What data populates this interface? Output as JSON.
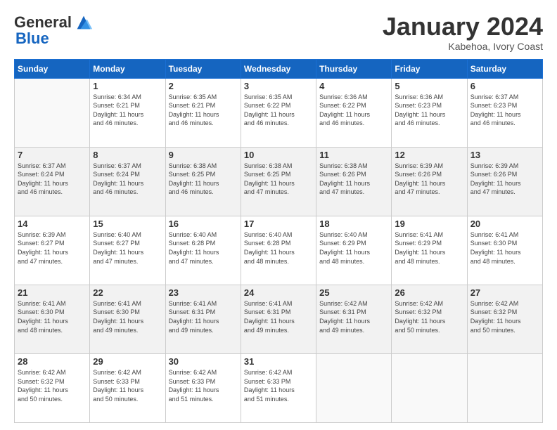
{
  "header": {
    "logo_general": "General",
    "logo_blue": "Blue",
    "month_title": "January 2024",
    "subtitle": "Kabehoa, Ivory Coast"
  },
  "weekdays": [
    "Sunday",
    "Monday",
    "Tuesday",
    "Wednesday",
    "Thursday",
    "Friday",
    "Saturday"
  ],
  "weeks": [
    [
      {
        "day": "",
        "sunrise": "",
        "sunset": "",
        "daylight": ""
      },
      {
        "day": "1",
        "sunrise": "Sunrise: 6:34 AM",
        "sunset": "Sunset: 6:21 PM",
        "daylight": "Daylight: 11 hours and 46 minutes."
      },
      {
        "day": "2",
        "sunrise": "Sunrise: 6:35 AM",
        "sunset": "Sunset: 6:21 PM",
        "daylight": "Daylight: 11 hours and 46 minutes."
      },
      {
        "day": "3",
        "sunrise": "Sunrise: 6:35 AM",
        "sunset": "Sunset: 6:22 PM",
        "daylight": "Daylight: 11 hours and 46 minutes."
      },
      {
        "day": "4",
        "sunrise": "Sunrise: 6:36 AM",
        "sunset": "Sunset: 6:22 PM",
        "daylight": "Daylight: 11 hours and 46 minutes."
      },
      {
        "day": "5",
        "sunrise": "Sunrise: 6:36 AM",
        "sunset": "Sunset: 6:23 PM",
        "daylight": "Daylight: 11 hours and 46 minutes."
      },
      {
        "day": "6",
        "sunrise": "Sunrise: 6:37 AM",
        "sunset": "Sunset: 6:23 PM",
        "daylight": "Daylight: 11 hours and 46 minutes."
      }
    ],
    [
      {
        "day": "7",
        "sunrise": "Sunrise: 6:37 AM",
        "sunset": "Sunset: 6:24 PM",
        "daylight": "Daylight: 11 hours and 46 minutes."
      },
      {
        "day": "8",
        "sunrise": "Sunrise: 6:37 AM",
        "sunset": "Sunset: 6:24 PM",
        "daylight": "Daylight: 11 hours and 46 minutes."
      },
      {
        "day": "9",
        "sunrise": "Sunrise: 6:38 AM",
        "sunset": "Sunset: 6:25 PM",
        "daylight": "Daylight: 11 hours and 46 minutes."
      },
      {
        "day": "10",
        "sunrise": "Sunrise: 6:38 AM",
        "sunset": "Sunset: 6:25 PM",
        "daylight": "Daylight: 11 hours and 47 minutes."
      },
      {
        "day": "11",
        "sunrise": "Sunrise: 6:38 AM",
        "sunset": "Sunset: 6:26 PM",
        "daylight": "Daylight: 11 hours and 47 minutes."
      },
      {
        "day": "12",
        "sunrise": "Sunrise: 6:39 AM",
        "sunset": "Sunset: 6:26 PM",
        "daylight": "Daylight: 11 hours and 47 minutes."
      },
      {
        "day": "13",
        "sunrise": "Sunrise: 6:39 AM",
        "sunset": "Sunset: 6:26 PM",
        "daylight": "Daylight: 11 hours and 47 minutes."
      }
    ],
    [
      {
        "day": "14",
        "sunrise": "Sunrise: 6:39 AM",
        "sunset": "Sunset: 6:27 PM",
        "daylight": "Daylight: 11 hours and 47 minutes."
      },
      {
        "day": "15",
        "sunrise": "Sunrise: 6:40 AM",
        "sunset": "Sunset: 6:27 PM",
        "daylight": "Daylight: 11 hours and 47 minutes."
      },
      {
        "day": "16",
        "sunrise": "Sunrise: 6:40 AM",
        "sunset": "Sunset: 6:28 PM",
        "daylight": "Daylight: 11 hours and 47 minutes."
      },
      {
        "day": "17",
        "sunrise": "Sunrise: 6:40 AM",
        "sunset": "Sunset: 6:28 PM",
        "daylight": "Daylight: 11 hours and 48 minutes."
      },
      {
        "day": "18",
        "sunrise": "Sunrise: 6:40 AM",
        "sunset": "Sunset: 6:29 PM",
        "daylight": "Daylight: 11 hours and 48 minutes."
      },
      {
        "day": "19",
        "sunrise": "Sunrise: 6:41 AM",
        "sunset": "Sunset: 6:29 PM",
        "daylight": "Daylight: 11 hours and 48 minutes."
      },
      {
        "day": "20",
        "sunrise": "Sunrise: 6:41 AM",
        "sunset": "Sunset: 6:30 PM",
        "daylight": "Daylight: 11 hours and 48 minutes."
      }
    ],
    [
      {
        "day": "21",
        "sunrise": "Sunrise: 6:41 AM",
        "sunset": "Sunset: 6:30 PM",
        "daylight": "Daylight: 11 hours and 48 minutes."
      },
      {
        "day": "22",
        "sunrise": "Sunrise: 6:41 AM",
        "sunset": "Sunset: 6:30 PM",
        "daylight": "Daylight: 11 hours and 49 minutes."
      },
      {
        "day": "23",
        "sunrise": "Sunrise: 6:41 AM",
        "sunset": "Sunset: 6:31 PM",
        "daylight": "Daylight: 11 hours and 49 minutes."
      },
      {
        "day": "24",
        "sunrise": "Sunrise: 6:41 AM",
        "sunset": "Sunset: 6:31 PM",
        "daylight": "Daylight: 11 hours and 49 minutes."
      },
      {
        "day": "25",
        "sunrise": "Sunrise: 6:42 AM",
        "sunset": "Sunset: 6:31 PM",
        "daylight": "Daylight: 11 hours and 49 minutes."
      },
      {
        "day": "26",
        "sunrise": "Sunrise: 6:42 AM",
        "sunset": "Sunset: 6:32 PM",
        "daylight": "Daylight: 11 hours and 50 minutes."
      },
      {
        "day": "27",
        "sunrise": "Sunrise: 6:42 AM",
        "sunset": "Sunset: 6:32 PM",
        "daylight": "Daylight: 11 hours and 50 minutes."
      }
    ],
    [
      {
        "day": "28",
        "sunrise": "Sunrise: 6:42 AM",
        "sunset": "Sunset: 6:32 PM",
        "daylight": "Daylight: 11 hours and 50 minutes."
      },
      {
        "day": "29",
        "sunrise": "Sunrise: 6:42 AM",
        "sunset": "Sunset: 6:33 PM",
        "daylight": "Daylight: 11 hours and 50 minutes."
      },
      {
        "day": "30",
        "sunrise": "Sunrise: 6:42 AM",
        "sunset": "Sunset: 6:33 PM",
        "daylight": "Daylight: 11 hours and 51 minutes."
      },
      {
        "day": "31",
        "sunrise": "Sunrise: 6:42 AM",
        "sunset": "Sunset: 6:33 PM",
        "daylight": "Daylight: 11 hours and 51 minutes."
      },
      {
        "day": "",
        "sunrise": "",
        "sunset": "",
        "daylight": ""
      },
      {
        "day": "",
        "sunrise": "",
        "sunset": "",
        "daylight": ""
      },
      {
        "day": "",
        "sunrise": "",
        "sunset": "",
        "daylight": ""
      }
    ]
  ]
}
